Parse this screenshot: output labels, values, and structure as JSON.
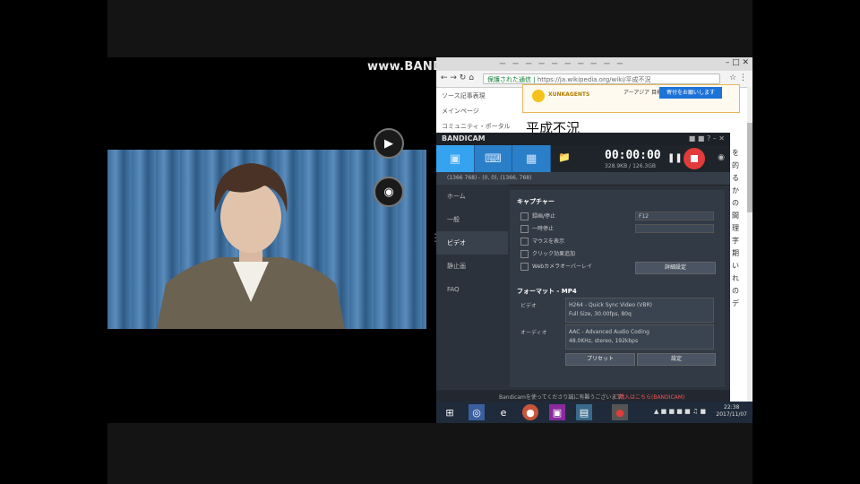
{
  "watermark": "www.BANDICAM.com",
  "browser": {
    "tab_text": "ー ー ー ー ー ー ー ー ー ー",
    "address_secure": "保護された通信",
    "address_url": "https://ja.wikipedia.org/wiki/平成不況",
    "left_links": [
      "ソース記事表現",
      "メインページ",
      "コミュニティ・ポータル"
    ],
    "banner_logo_text": "XUNKAGENTS",
    "banner_middle": "アーアジア 目標です",
    "banner_button": "寄付をお願いします",
    "page_title": "平成不況"
  },
  "bandicam": {
    "brand": "BANDICAM",
    "time": "00:00:00",
    "size": "328.9KB / 126.3GB",
    "target": "(1366 768) - (0, 0), (1366, 768)",
    "sidebar": [
      "ホーム",
      "一般",
      "ビデオ",
      "静止画",
      "FAQ"
    ],
    "capture_section": "キャプチャー",
    "checks": [
      "録画/停止",
      "一時停止",
      "マウスを表示",
      "クリック効果追加",
      "Webカメラオーバーレイ"
    ],
    "hotkey_field": "F12",
    "settings_button": "詳細設定",
    "format_section": "フォーマット - MP4",
    "video_label": "ビデオ",
    "video_desc_1": "H264 - Quick Sync Video (VBR)",
    "video_desc_2": "Full Size, 30.00fps, 80q",
    "audio_label": "オーディオ",
    "audio_desc_1": "AAC - Advanced Audio Coding",
    "audio_desc_2": "48.0KHz, stereo, 192kbps",
    "preset_button": "プリセット",
    "settings2_button": "設定",
    "footer_text": "Bandicamを使ってくださり誠に有難うございます",
    "footer_link": "ご購入はこちら(BANDICAM)"
  },
  "taskbar": {
    "clock_time": "22:38",
    "clock_date": "2017/11/07"
  }
}
